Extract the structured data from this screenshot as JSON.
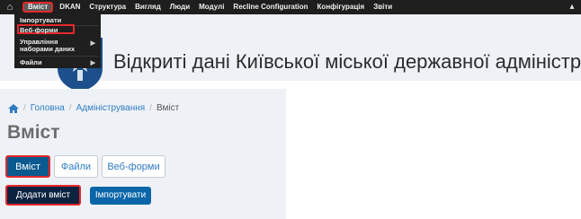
{
  "toolbar": {
    "home_icon": "home-icon",
    "items": [
      "Вміст",
      "DKAN",
      "Структура",
      "Вигляд",
      "Люди",
      "Модулі",
      "Recline Configuration",
      "Конфігурація",
      "Звіти"
    ]
  },
  "dropdown": {
    "items": [
      "Імпортувати",
      "Веб-форми",
      "Управління наборами даних",
      "Файли"
    ]
  },
  "banner": {
    "site_name": "Відкриті дані Київської міської державної адміністраці"
  },
  "breadcrumb": [
    "Головна",
    "Адміністрування",
    "Вміст"
  ],
  "page": {
    "title": "Вміст",
    "tabs": [
      "Вміст",
      "Файли",
      "Веб-форми"
    ],
    "actions": {
      "add_content": "Додати вміст",
      "import": "Імпортувати"
    }
  },
  "colors": {
    "toolbar_bg": "#1e1e1e",
    "highlight_red": "#e4282b",
    "primary_blue": "#0a5a8f",
    "link_blue": "#2f7bbf"
  }
}
